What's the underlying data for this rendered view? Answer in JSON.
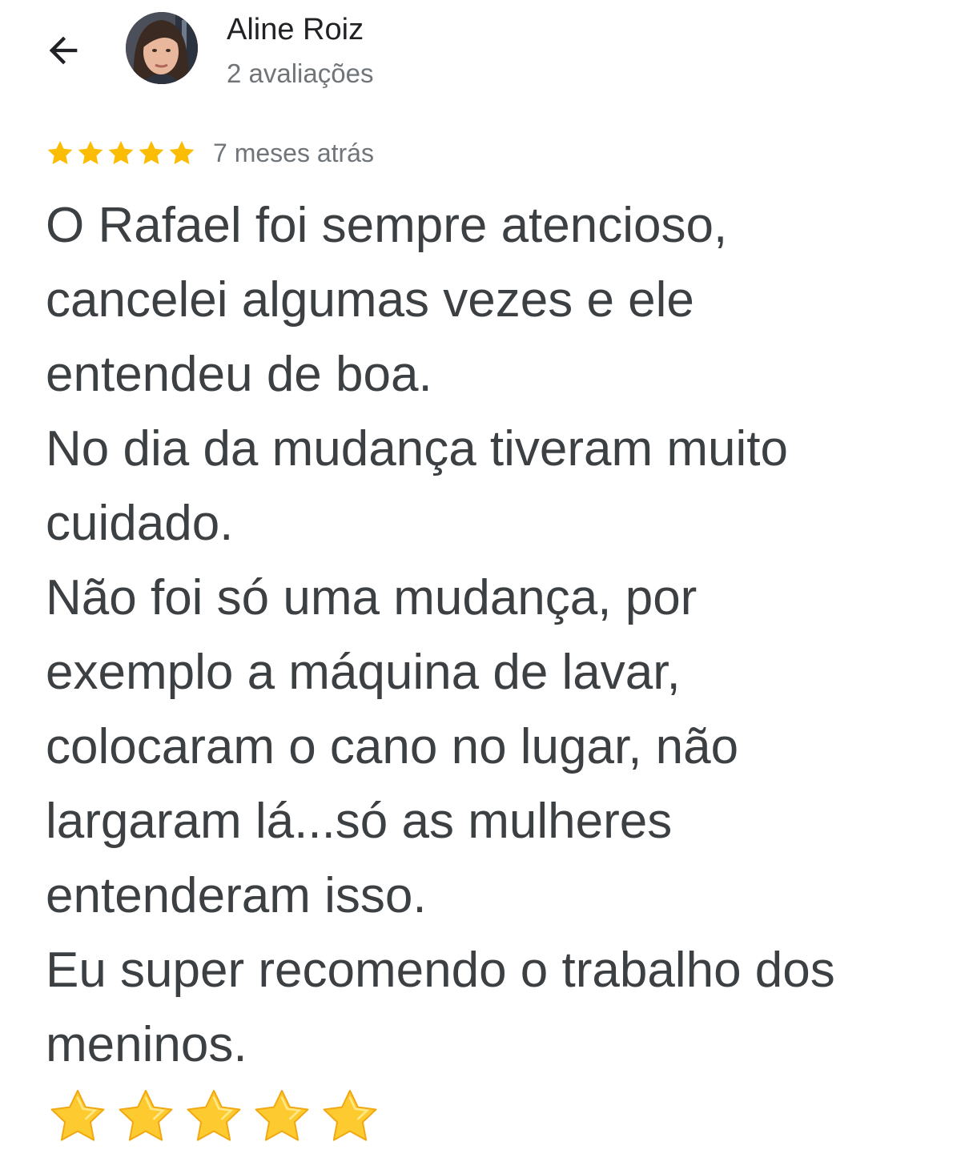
{
  "header": {
    "back_icon": "arrow-back-icon",
    "reviewer_name": "Aline Roiz",
    "review_count": "2 avaliações",
    "avatar_icon": "profile-photo"
  },
  "review": {
    "rating": 5,
    "rating_max": 5,
    "star_color": "#fbbc04",
    "date": "7 meses atrás",
    "text": "O Rafael foi sempre atencioso,\ncancelei algumas vezes e ele\nentendeu de boa.\nNo dia da mudança tiveram muito\ncuidado.\nNão foi só uma mudança, por\nexemplo a máquina de lavar,\ncolocaram o cano no lugar, não\nlargaram lá...só as mulheres\nentenderam isso.\nEu super recomendo o trabalho dos\nmeninos.",
    "emoji_stars": 5,
    "emoji_icon": "star-emoji"
  },
  "colors": {
    "primary_text": "#202124",
    "body_text": "#3c4043",
    "secondary_text": "#70757a",
    "rating_star": "#fbbc04",
    "emoji_star": "#fdcb2f"
  }
}
